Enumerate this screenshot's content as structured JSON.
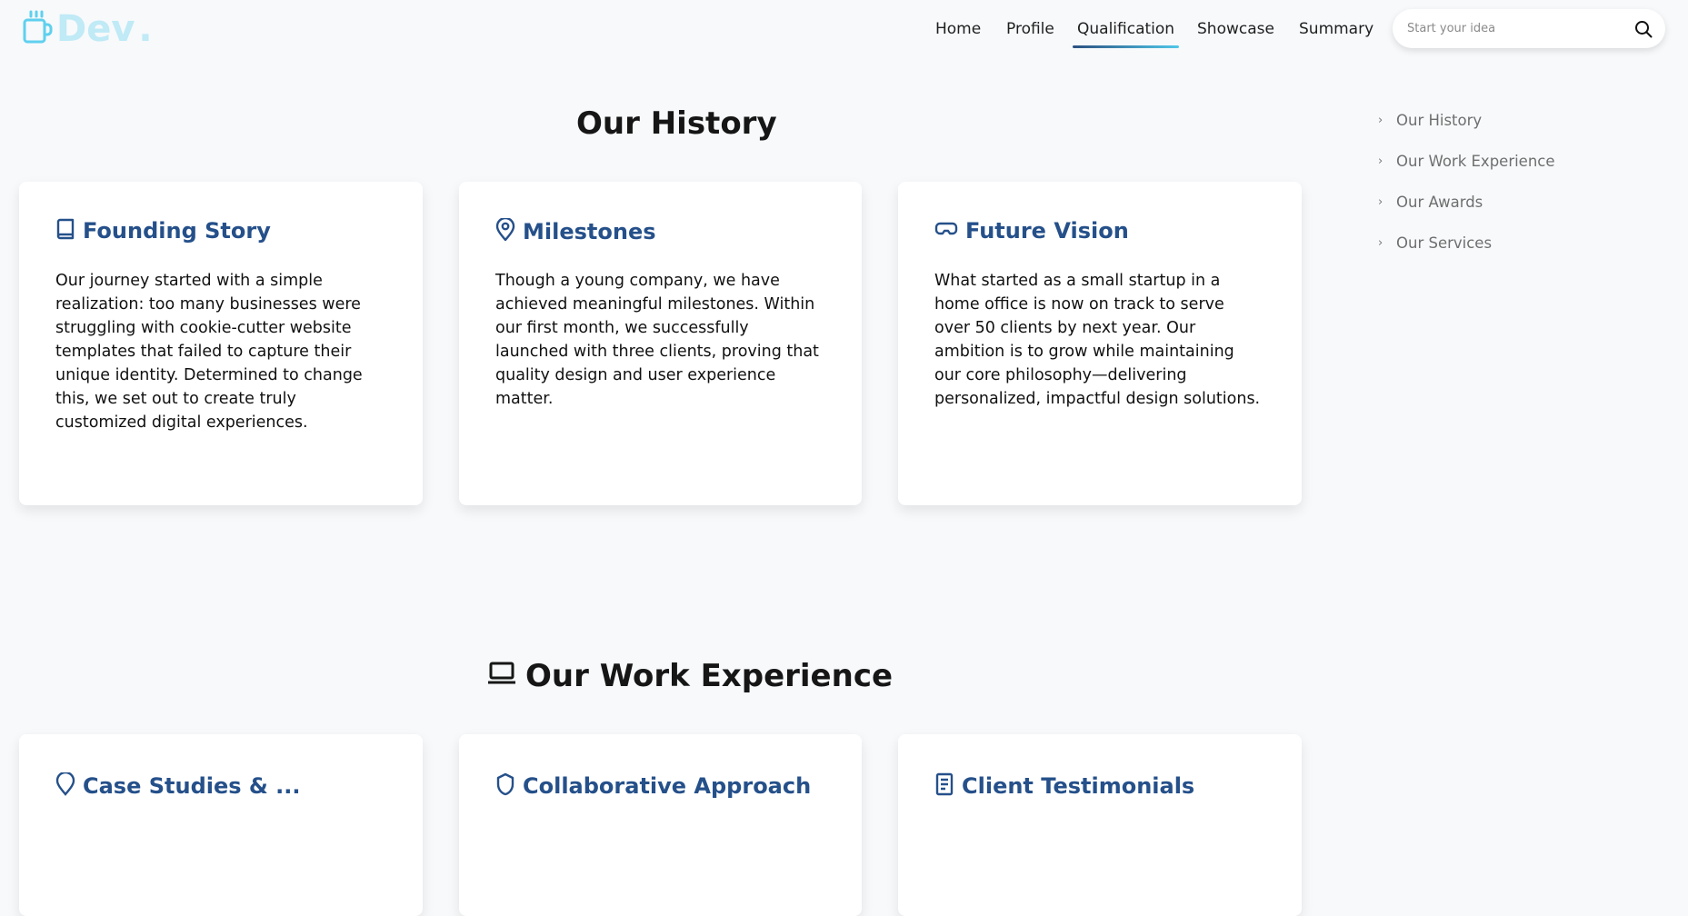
{
  "brand": {
    "name": "Dev",
    "dot": "."
  },
  "nav": {
    "items": [
      "Home",
      "Profile",
      "Qualification",
      "Showcase",
      "Summary"
    ],
    "active": "Qualification"
  },
  "search": {
    "placeholder": "Start your idea"
  },
  "toc": {
    "items": [
      "Our History",
      "Our Work Experience",
      "Our Awards",
      "Our Services"
    ]
  },
  "history": {
    "title": "Our History",
    "cards": [
      {
        "title": "Founding Story",
        "icon": "book-icon",
        "body": "Our journey started with a simple realization: too many businesses were struggling with cookie-cutter website templates that failed to capture their unique identity. Determined to change this, we set out to create truly customized digital experiences."
      },
      {
        "title": "Milestones",
        "icon": "map-pin-icon",
        "body": "Though a young company, we have achieved meaningful milestones. Within our first month, we successfully launched with three clients, proving that quality design and user experience matter."
      },
      {
        "title": "Future Vision",
        "icon": "vr-goggles-icon",
        "body": "What started as a small startup in a home office is now on track to serve over 50 clients by next year. Our ambition is to grow while maintaining our core philosophy—delivering personalized, impactful design solutions."
      }
    ]
  },
  "work": {
    "title": "Our Work Experience",
    "icon": "laptop-icon",
    "cards": [
      {
        "title": "Case Studies & ...",
        "icon": "pin-icon"
      },
      {
        "title": "Collaborative Approach",
        "icon": "shield-icon"
      },
      {
        "title": "Client Testimonials",
        "icon": "document-icon"
      }
    ]
  },
  "colors": {
    "accent": "#25508a",
    "accent_light": "#4fc8e8",
    "logo": "#bfeaf6",
    "background": "#f7f9fb"
  }
}
